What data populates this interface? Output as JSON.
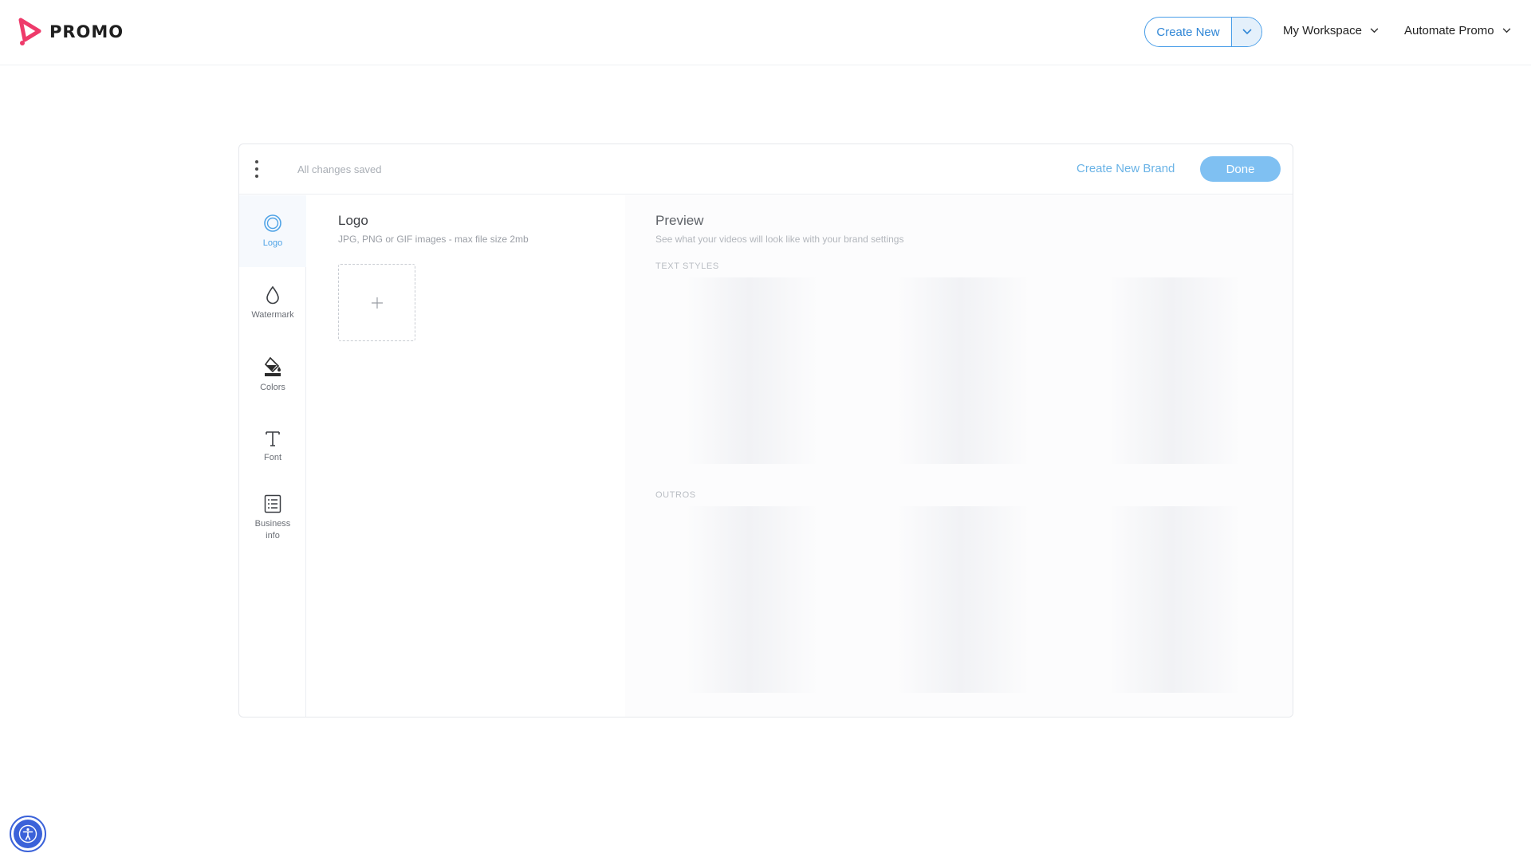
{
  "brand": {
    "name": "PROMO"
  },
  "header": {
    "create_new_label": "Create New",
    "workspace_label": "My Workspace",
    "automate_label": "Automate Promo"
  },
  "toolbar": {
    "status": "All changes saved",
    "create_brand_label": "Create New Brand",
    "done_label": "Done"
  },
  "sidebar": {
    "items": [
      {
        "label": "Logo",
        "icon": "logo-ring-icon",
        "active": true
      },
      {
        "label": "Watermark",
        "icon": "drop-icon"
      },
      {
        "label": "Colors",
        "icon": "paint-bucket-icon"
      },
      {
        "label": "Font",
        "icon": "font-t-icon"
      },
      {
        "label": "Business info",
        "icon": "document-list-icon"
      }
    ]
  },
  "logo_panel": {
    "title": "Logo",
    "subtitle": "JPG, PNG or GIF images - max file size 2mb"
  },
  "preview": {
    "title": "Preview",
    "subtitle": "See what your videos will look like with your brand settings",
    "text_styles_label": "TEXT STYLES",
    "outros_label": "OUTROS"
  },
  "colors": {
    "accent": "#4a9ee8",
    "done_button": "#7fc0f2",
    "brand_pink": "#ee3a6a",
    "a11y": "#3b62d9"
  }
}
